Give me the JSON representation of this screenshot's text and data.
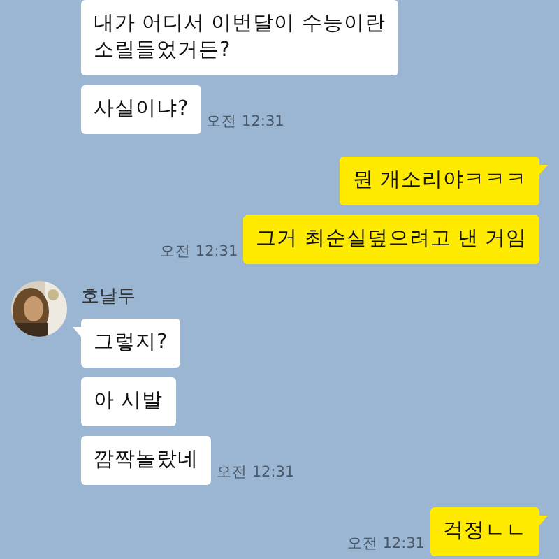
{
  "groups": [
    {
      "kind": "incoming",
      "messages": [
        {
          "text": "내가 어디서 이번달이 수능이란\n소릴들었거든?",
          "tail": false
        },
        {
          "text": "사실이냐?",
          "tail": false,
          "time": "오전 12:31"
        }
      ]
    },
    {
      "kind": "outgoing",
      "messages": [
        {
          "text": "뭔 개소리야ㅋㅋㅋ",
          "tail": true
        },
        {
          "text": "그거 최순실덮으려고 낸 거임",
          "tail": false,
          "time": "오전 12:31"
        }
      ]
    },
    {
      "kind": "incoming",
      "sender": {
        "name": "호날두"
      },
      "messages": [
        {
          "text": "그렇지?",
          "tail": true
        },
        {
          "text": "아 시발",
          "tail": false
        },
        {
          "text": "깜짝놀랐네",
          "tail": false,
          "time": "오전 12:31"
        }
      ]
    },
    {
      "kind": "outgoing",
      "messages": [
        {
          "text": "걱정ㄴㄴ",
          "tail": true,
          "time": "오전 12:31"
        }
      ]
    }
  ]
}
